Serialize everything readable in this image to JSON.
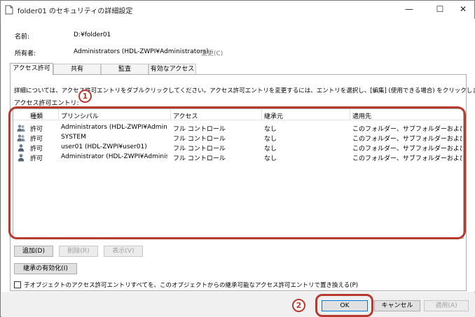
{
  "window": {
    "title": "folder01 のセキュリティの詳細設定",
    "minimize_glyph": "—",
    "maximize_glyph": "☐",
    "close_glyph": "✕"
  },
  "info": {
    "name_label": "名前:",
    "name_value": "D:¥folder01",
    "owner_label": "所有者:",
    "owner_value": "Administrators (HDL-ZWPI¥Administrators)",
    "owner_change_link": "変更(C)"
  },
  "tabs": [
    {
      "label": "アクセス許可",
      "active": true
    },
    {
      "label": "共有",
      "active": false
    },
    {
      "label": "監査",
      "active": false
    },
    {
      "label": "有効なアクセス",
      "active": false
    }
  ],
  "panel": {
    "description": "詳細については、アクセス許可エントリをダブルクリックしてください。アクセス許可エントリを変更するには、エントリを選択し、[編集] (使用できる場合) をクリックします。",
    "entries_label": "アクセス許可エントリ:"
  },
  "list": {
    "columns": [
      "種類",
      "プリンシパル",
      "アクセス",
      "継承元",
      "適用先"
    ],
    "rows": [
      {
        "icon": "group-users-icon",
        "type": "許可",
        "principal": "Administrators (HDL-ZWPI¥Adminis...",
        "access": "フル コントロール",
        "inherited": "なし",
        "applies": "このフォルダー、サブフォルダーおよびファイル"
      },
      {
        "icon": "group-users-icon",
        "type": "許可",
        "principal": "SYSTEM",
        "access": "フル コントロール",
        "inherited": "なし",
        "applies": "このフォルダー、サブフォルダーおよびファイル"
      },
      {
        "icon": "user-icon",
        "type": "許可",
        "principal": "user01 (HDL-ZWPI¥user01)",
        "access": "フル コントロール",
        "inherited": "なし",
        "applies": "このフォルダー、サブフォルダーおよびファイル"
      },
      {
        "icon": "user-icon",
        "type": "許可",
        "principal": "Administrator (HDL-ZWPI¥Administ...",
        "access": "フル コントロール",
        "inherited": "なし",
        "applies": "このフォルダー、サブフォルダーおよびファイル"
      }
    ]
  },
  "buttons": {
    "add": "追加(D)",
    "remove": "削除(R)",
    "view": "表示(V)",
    "enable_inheritance": "継承の有効化(I)",
    "ok": "OK",
    "cancel": "キャンセル",
    "apply": "適用(A)"
  },
  "replace_checkbox_label": "子オブジェクトのアクセス許可エントリすべてを、このオブジェクトからの継承可能なアクセス許可エントリで置き換える(P)",
  "callouts": {
    "one": "1",
    "two": "2"
  },
  "colors": {
    "callout": "#b73a2f",
    "accent": "#0078d7"
  }
}
